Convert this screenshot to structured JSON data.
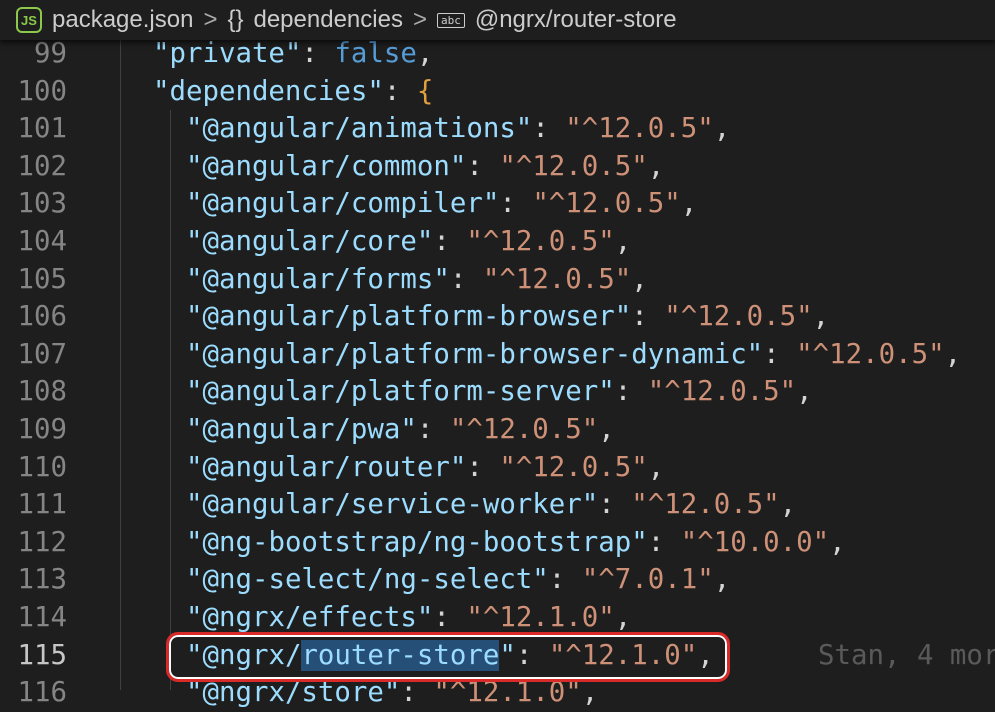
{
  "breadcrumb": {
    "file_icon": "nodejs-icon",
    "file": "package.json",
    "object_icon": "{}",
    "object": "dependencies",
    "string_icon": "abc",
    "current": "@ngrx/router-store"
  },
  "lines": [
    {
      "n": "99",
      "key": "\"private\"",
      "sep": ": ",
      "val": "false",
      "tail": ",",
      "type": "kw",
      "level": 1
    },
    {
      "n": "100",
      "key": "\"dependencies\"",
      "sep": ": ",
      "val": "{",
      "tail": "",
      "type": "brace",
      "level": 1
    },
    {
      "n": "101",
      "key": "\"@angular/animations\"",
      "sep": ": ",
      "val": "\"^12.0.5\"",
      "tail": ",",
      "type": "str",
      "level": 2
    },
    {
      "n": "102",
      "key": "\"@angular/common\"",
      "sep": ": ",
      "val": "\"^12.0.5\"",
      "tail": ",",
      "type": "str",
      "level": 2
    },
    {
      "n": "103",
      "key": "\"@angular/compiler\"",
      "sep": ": ",
      "val": "\"^12.0.5\"",
      "tail": ",",
      "type": "str",
      "level": 2
    },
    {
      "n": "104",
      "key": "\"@angular/core\"",
      "sep": ": ",
      "val": "\"^12.0.5\"",
      "tail": ",",
      "type": "str",
      "level": 2
    },
    {
      "n": "105",
      "key": "\"@angular/forms\"",
      "sep": ": ",
      "val": "\"^12.0.5\"",
      "tail": ",",
      "type": "str",
      "level": 2
    },
    {
      "n": "106",
      "key": "\"@angular/platform-browser\"",
      "sep": ": ",
      "val": "\"^12.0.5\"",
      "tail": ",",
      "type": "str",
      "level": 2
    },
    {
      "n": "107",
      "key": "\"@angular/platform-browser-dynamic\"",
      "sep": ": ",
      "val": "\"^12.0.5\"",
      "tail": ",",
      "type": "str",
      "level": 2
    },
    {
      "n": "108",
      "key": "\"@angular/platform-server\"",
      "sep": ": ",
      "val": "\"^12.0.5\"",
      "tail": ",",
      "type": "str",
      "level": 2
    },
    {
      "n": "109",
      "key": "\"@angular/pwa\"",
      "sep": ": ",
      "val": "\"^12.0.5\"",
      "tail": ",",
      "type": "str",
      "level": 2
    },
    {
      "n": "110",
      "key": "\"@angular/router\"",
      "sep": ": ",
      "val": "\"^12.0.5\"",
      "tail": ",",
      "type": "str",
      "level": 2
    },
    {
      "n": "111",
      "key": "\"@angular/service-worker\"",
      "sep": ": ",
      "val": "\"^12.0.5\"",
      "tail": ",",
      "type": "str",
      "level": 2
    },
    {
      "n": "112",
      "key": "\"@ng-bootstrap/ng-bootstrap\"",
      "sep": ": ",
      "val": "\"^10.0.0\"",
      "tail": ",",
      "type": "str",
      "level": 2
    },
    {
      "n": "113",
      "key": "\"@ng-select/ng-select\"",
      "sep": ": ",
      "val": "\"^7.0.1\"",
      "tail": ",",
      "type": "str",
      "level": 2
    },
    {
      "n": "114",
      "key": "\"@ngrx/effects\"",
      "sep": ": ",
      "val": "\"^12.1.0\"",
      "tail": ",",
      "type": "str",
      "level": 2
    }
  ],
  "current_line": {
    "n": "115",
    "key_prefix": "\"@ngrx/",
    "key_selected": "router-store",
    "key_suffix": "\"",
    "sep": ": ",
    "val": "\"^12.1.0\"",
    "tail": ",",
    "blame": "Stan, 4 mor"
  },
  "next_line": {
    "n": "116",
    "key": "\"@ngrx/store\"",
    "sep": ": ",
    "val": "\"^12.1.0\"",
    "tail": ","
  }
}
